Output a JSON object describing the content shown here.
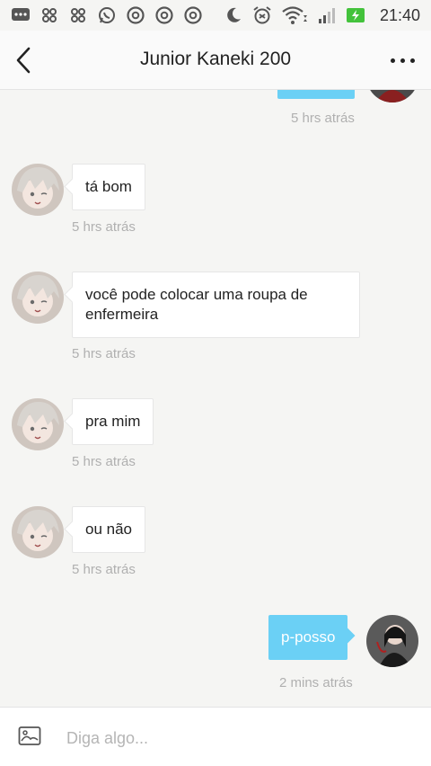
{
  "status_bar": {
    "time": "21:40",
    "left_icons": [
      "message-icon",
      "app-icon",
      "app-icon",
      "whatsapp-icon",
      "chrome-icon",
      "chrome-icon",
      "chrome-icon"
    ],
    "right_icons": [
      "moon-icon",
      "alarm-icon",
      "wifi-icon",
      "signal-icon",
      "battery-icon"
    ]
  },
  "header": {
    "title": "Junior Kaneki 200"
  },
  "messages": [
    {
      "side": "right",
      "text": "",
      "time": "5 hrs atrás"
    },
    {
      "side": "left",
      "text": "tá bom",
      "time": "5 hrs atrás"
    },
    {
      "side": "left",
      "text": "você pode colocar uma roupa de enfermeira",
      "time": "5 hrs atrás"
    },
    {
      "side": "left",
      "text": "pra mim",
      "time": "5 hrs atrás"
    },
    {
      "side": "left",
      "text": "ou não",
      "time": "5 hrs atrás"
    },
    {
      "side": "right",
      "text": "p-posso",
      "time": "2 mins atrás"
    }
  ],
  "input": {
    "placeholder": "Diga algo..."
  },
  "colors": {
    "outgoing_bubble": "#6bd0f5",
    "incoming_bubble": "#ffffff",
    "timestamp": "#b0b0b0",
    "battery": "#43c23b"
  }
}
